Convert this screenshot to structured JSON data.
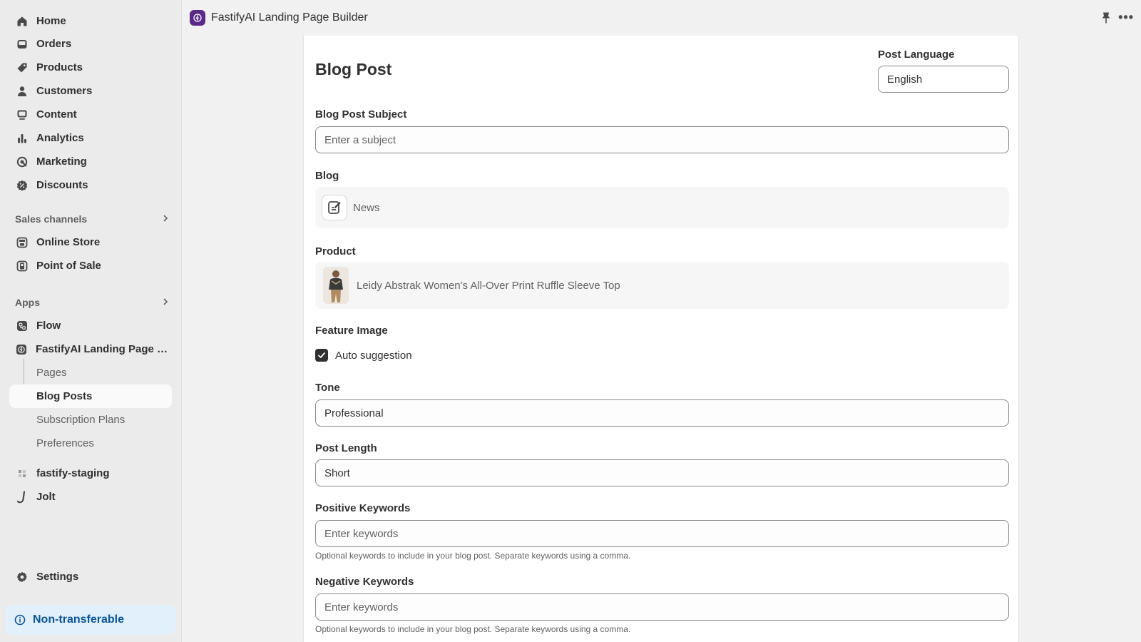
{
  "sidebar": {
    "main_items": [
      {
        "label": "Home",
        "icon": "home-icon"
      },
      {
        "label": "Orders",
        "icon": "orders-icon"
      },
      {
        "label": "Products",
        "icon": "tag-icon"
      },
      {
        "label": "Customers",
        "icon": "person-icon"
      },
      {
        "label": "Content",
        "icon": "content-icon"
      },
      {
        "label": "Analytics",
        "icon": "bar-chart-icon"
      },
      {
        "label": "Marketing",
        "icon": "target-icon"
      },
      {
        "label": "Discounts",
        "icon": "discount-icon"
      }
    ],
    "sales_channels": {
      "title": "Sales channels",
      "items": [
        {
          "label": "Online Store",
          "icon": "store-icon"
        },
        {
          "label": "Point of Sale",
          "icon": "pos-icon"
        }
      ]
    },
    "apps": {
      "title": "Apps",
      "items": [
        {
          "label": "Flow",
          "icon": "flow-icon"
        },
        {
          "label": "FastifyAI Landing Page Bu...",
          "icon": "fastify-icon"
        }
      ],
      "sub_items": [
        {
          "label": "Pages",
          "active": false
        },
        {
          "label": "Blog Posts",
          "active": true
        },
        {
          "label": "Subscription Plans",
          "active": false
        },
        {
          "label": "Preferences",
          "active": false
        }
      ],
      "extra_items": [
        {
          "label": "fastify-staging",
          "icon": "grid-app-icon"
        },
        {
          "label": "Jolt",
          "icon": "jolt-icon"
        }
      ]
    },
    "settings_label": "Settings",
    "non_transferable_label": "Non-transferable"
  },
  "topbar": {
    "app_title": "FastifyAI Landing Page Builder"
  },
  "form": {
    "title": "Blog Post",
    "language": {
      "label": "Post Language",
      "value": "English"
    },
    "subject": {
      "label": "Blog Post Subject",
      "placeholder": "Enter a subject"
    },
    "blog": {
      "label": "Blog",
      "value": "News"
    },
    "product": {
      "label": "Product",
      "value": "Leidy Abstrak Women's All-Over Print Ruffle Sleeve Top"
    },
    "feature_image": {
      "label": "Feature Image",
      "checkbox_label": "Auto suggestion",
      "checked": true
    },
    "tone": {
      "label": "Tone",
      "value": "Professional"
    },
    "post_length": {
      "label": "Post Length",
      "value": "Short"
    },
    "positive_keywords": {
      "label": "Positive Keywords",
      "placeholder": "Enter keywords",
      "help": "Optional keywords to include in your blog post. Separate keywords using a comma."
    },
    "negative_keywords": {
      "label": "Negative Keywords",
      "placeholder": "Enter keywords",
      "help": "Optional keywords to include in your blog post. Separate keywords using a comma."
    }
  },
  "colors": {
    "app_badge": "#5b2a86",
    "info_bg": "#e2f0fb",
    "info_text": "#0a5496"
  }
}
